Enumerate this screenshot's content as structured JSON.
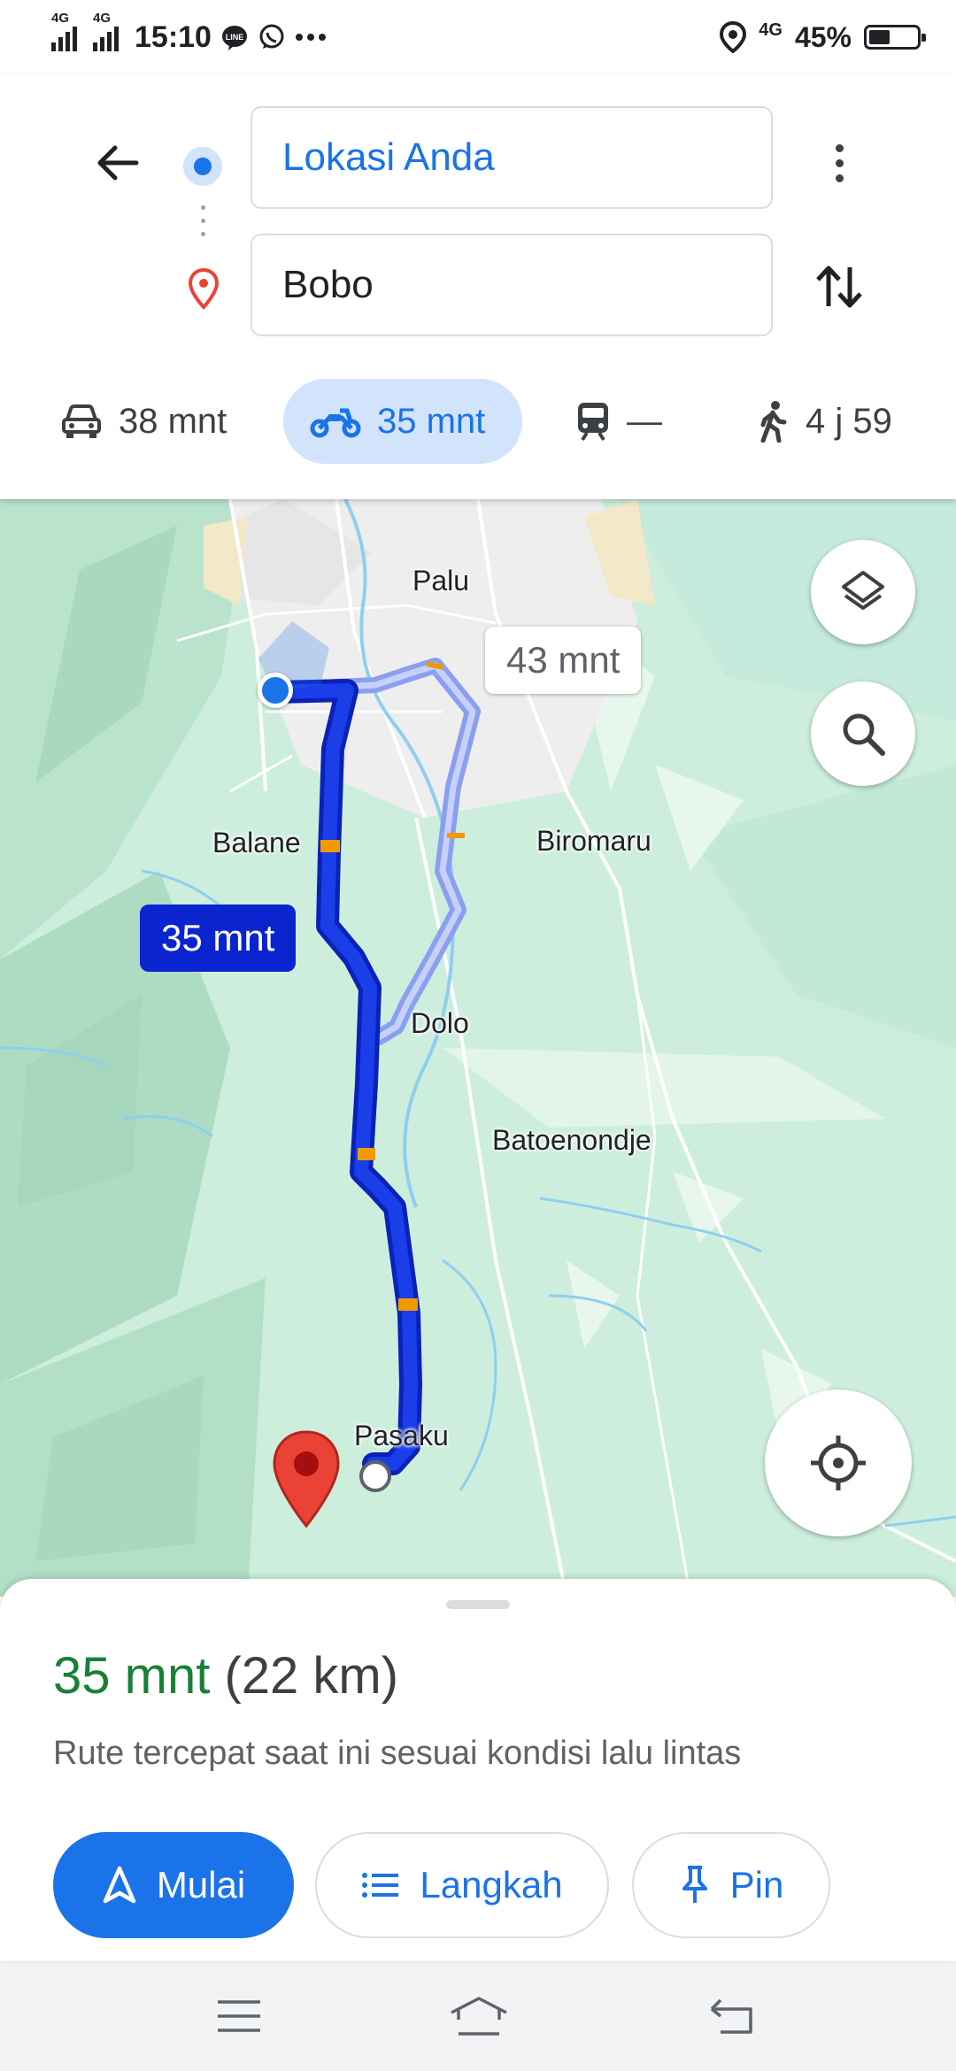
{
  "status_bar": {
    "time": "15:10",
    "network_1": "4G",
    "network_2": "4G",
    "notification_icons": [
      "line-icon",
      "whatsapp-icon",
      "more-notifications-icon"
    ],
    "right_network": "4G",
    "battery": "45%",
    "battery_level": 0.45
  },
  "route_inputs": {
    "origin": "Lokasi Anda",
    "destination": "Bobo"
  },
  "travel_modes": [
    {
      "icon": "car-icon",
      "label": "38 mnt",
      "active": false
    },
    {
      "icon": "motorcycle-icon",
      "label": "35 mnt",
      "active": true
    },
    {
      "icon": "transit-icon",
      "label": "—",
      "active": false
    },
    {
      "icon": "walk-icon",
      "label": "4 j 59",
      "active": false
    }
  ],
  "map": {
    "places": [
      "Palu",
      "Balane",
      "Biromaru",
      "Dolo",
      "Batoenondje",
      "Pasaku"
    ],
    "route_labels": {
      "alternative": "43 mnt",
      "selected": "35 mnt"
    }
  },
  "bottom_sheet": {
    "duration": "35 mnt",
    "distance": "(22 km)",
    "description": "Rute tercepat saat ini sesuai kondisi lalu lintas",
    "buttons": {
      "start": "Mulai",
      "steps": "Langkah",
      "pin": "Pin"
    }
  },
  "colors": {
    "accent": "#1a73e8",
    "route_selected": "#1a3ee8",
    "route_alternative": "#8fa3f0",
    "duration_green": "#188038",
    "map_background": "#cdeedd",
    "destination_pin": "#ea4335"
  }
}
